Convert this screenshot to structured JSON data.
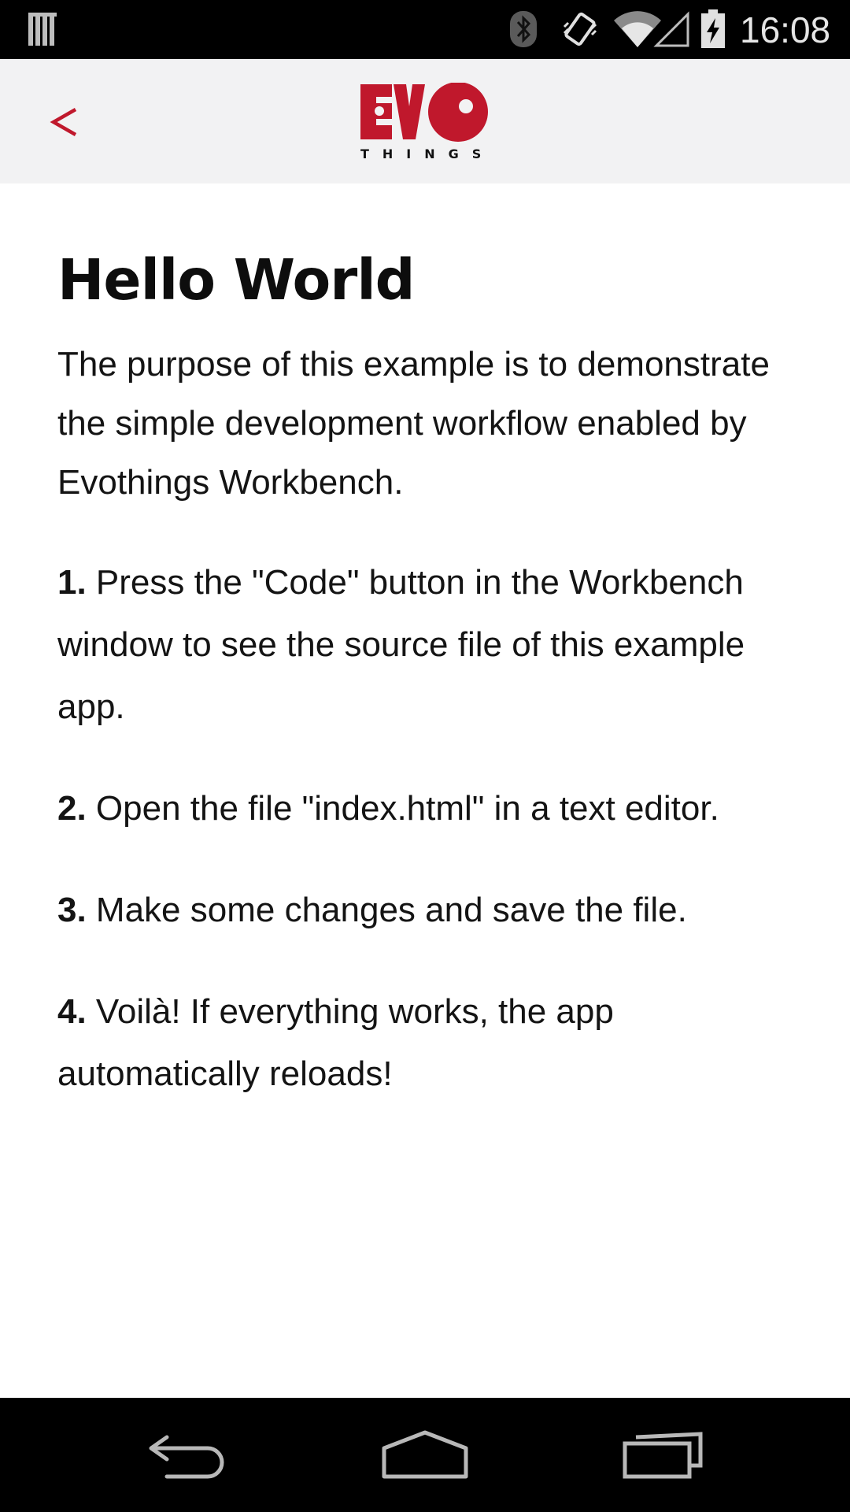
{
  "status_bar": {
    "time": "16:08",
    "icons": [
      "notification-bars-icon",
      "bluetooth-icon",
      "vibrate-icon",
      "wifi-icon",
      "signal-icon",
      "battery-charging-icon"
    ]
  },
  "header": {
    "back_label": "<",
    "logo": {
      "main": "EVO",
      "sub": "THINGS"
    },
    "accent_color": "#c0182c"
  },
  "content": {
    "title": "Hello World",
    "intro": "The purpose of this example is to demonstrate the simple development workflow enabled by Evothings Workbench.",
    "steps": [
      {
        "num": "1.",
        "text": " Press the \"Code\" button in the Workbench window to see the source file of this example app."
      },
      {
        "num": "2.",
        "text": " Open the file \"index.html\" in a text editor."
      },
      {
        "num": "3.",
        "text": " Make some changes and save the file."
      },
      {
        "num": "4.",
        "text": " Voilà! If everything works, the app automatically reloads!"
      }
    ]
  },
  "nav_bar": {
    "icons": [
      "nav-back-icon",
      "nav-home-icon",
      "nav-recents-icon"
    ]
  }
}
